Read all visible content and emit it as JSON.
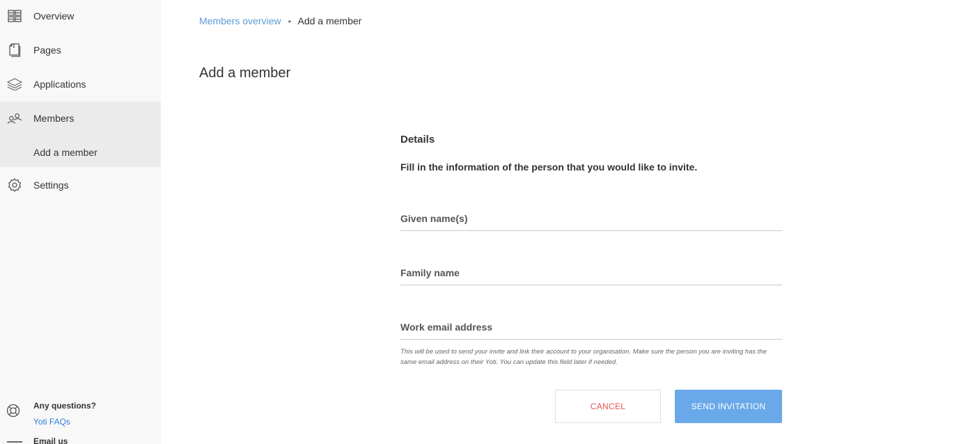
{
  "sidebar": {
    "items": [
      {
        "label": "Overview",
        "icon": "dashboard-icon"
      },
      {
        "label": "Pages",
        "icon": "pages-icon"
      },
      {
        "label": "Applications",
        "icon": "layers-icon"
      },
      {
        "label": "Members",
        "icon": "members-icon"
      },
      {
        "label": "Settings",
        "icon": "gear-icon"
      }
    ],
    "sub_item": "Add a member",
    "help": {
      "question": "Any questions?",
      "faq_link": "Yoti FAQs",
      "email": "Email us"
    }
  },
  "breadcrumb": {
    "parent": "Members overview",
    "separator": "▸",
    "current": "Add a member"
  },
  "page_title": "Add a member",
  "form": {
    "section_title": "Details",
    "section_desc": "Fill in the information of the person that you would like to invite.",
    "fields": {
      "given_name": {
        "label": "Given name(s)",
        "value": ""
      },
      "family_name": {
        "label": "Family name",
        "value": ""
      },
      "email": {
        "label": "Work email address",
        "value": ""
      }
    },
    "hint": "This will be used to send your invite and link their account to your organisation. Make sure the person you are inviting has the same email address on their Yoti. You can update this field later if needed.",
    "cancel_label": "CANCEL",
    "send_label": "SEND INVITATION"
  },
  "colors": {
    "accent": "#6aa9e9",
    "link": "#5b9bd9",
    "danger": "#e0564f",
    "sidebar_bg": "#f8f8f8",
    "sidebar_active": "#ebebeb"
  }
}
